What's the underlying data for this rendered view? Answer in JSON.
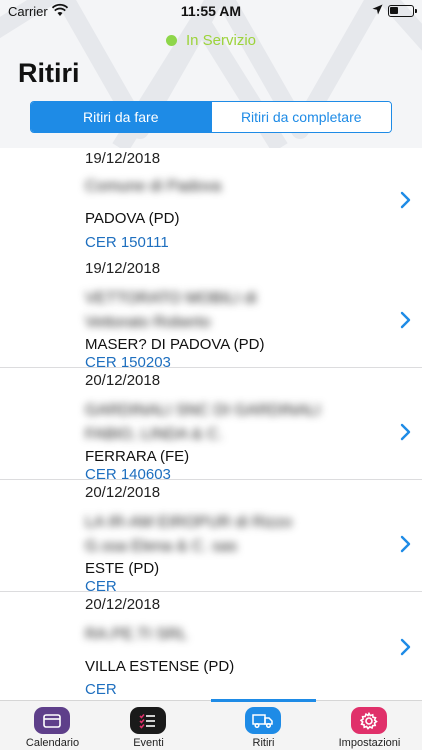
{
  "status_bar": {
    "carrier": "Carrier",
    "time": "11:55 AM",
    "battery_level": 0.4
  },
  "service_status": {
    "label": "In Servizio",
    "color": "#8ed64a"
  },
  "page": {
    "title": "Ritiri"
  },
  "segments": [
    {
      "label": "Ritiri da fare",
      "selected": true
    },
    {
      "label": "Ritiri da completare",
      "selected": false
    }
  ],
  "pickups": [
    {
      "date": "19/12/2018",
      "name_lines": [
        "Comune di Padova"
      ],
      "city": "PADOVA (PD)",
      "cer": "CER 150111"
    },
    {
      "date": "19/12/2018",
      "name_lines": [
        "VETTORATO MOBILI di",
        "Vettorato Roberto"
      ],
      "city": "MASER? DI PADOVA (PD)",
      "cer": "CER 150203"
    },
    {
      "date": "20/12/2018",
      "name_lines": [
        "GARDINALI SNC DI GARDINALI",
        "FABIO, LINDA & C."
      ],
      "city": "FERRARA (FE)",
      "cer": "CER 140603"
    },
    {
      "date": "20/12/2018",
      "name_lines": [
        "LA IR-AM EIROPUR di Rizzo",
        "G.ssa Elena & C. sas"
      ],
      "city": "ESTE (PD)",
      "cer": "CER"
    },
    {
      "date": "20/12/2018",
      "name_lines": [
        "RA.PE.TI SRL"
      ],
      "city": "VILLA ESTENSE (PD)",
      "cer": "CER"
    }
  ],
  "tabbar": {
    "selected": "Ritiri",
    "colors": {
      "calendario": "#5e3f8a",
      "eventi": "#1a1a1a",
      "ritiri": "#1e8be6",
      "impostazioni": "#e0306a"
    },
    "tabs": [
      {
        "label": "Calendario",
        "icon": "calendar-icon"
      },
      {
        "label": "Eventi",
        "icon": "checklist-icon"
      },
      {
        "label": "Ritiri",
        "icon": "truck-icon"
      },
      {
        "label": "Impostazioni",
        "icon": "gear-icon"
      }
    ]
  }
}
